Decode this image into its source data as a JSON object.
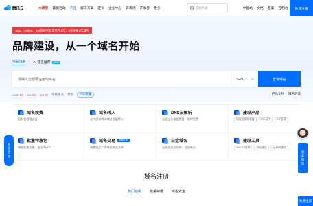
{
  "nav": {
    "brand": "腾讯云",
    "items": [
      {
        "label": "大模型",
        "style": "hot"
      },
      {
        "label": "最新活动",
        "style": ""
      },
      {
        "label": "产品",
        "style": "act"
      },
      {
        "label": "解决方案",
        "style": ""
      },
      {
        "label": "定价",
        "style": ""
      },
      {
        "label": "企业中心",
        "style": ""
      },
      {
        "label": "云市场",
        "style": ""
      },
      {
        "label": "开发者",
        "style": ""
      },
      {
        "label": "更多",
        "style": ""
      }
    ],
    "search_placeholder": "云服务器",
    "right": [
      "中国站",
      "文档",
      "备案",
      "控制台",
      "登录"
    ],
    "cta": "免费注册"
  },
  "hero": {
    "promo": ".site、.online、.fun等域名首年低至1元，9元注册1年域名",
    "title": "品牌建设，从一个域名开始",
    "tab_active": "域名注册",
    "tab_other": "AI 域名推荐",
    "tab_badge": "NEW",
    "search_placeholder": "请输入您想要注册的域名",
    "tld": ".com",
    "search_button": "查询域名",
    "prices": [
      {
        "tld": ".com",
        "price": "83"
      },
      {
        "tld": ".cn",
        "price": "33"
      },
      {
        "tld": ".net",
        "price": "86"
      }
    ],
    "price_label": "价格总览",
    "more": "更多",
    "more_link": "Cbe优惠",
    "right_links": [
      "产品文档",
      "域名验证"
    ]
  },
  "services": [
    {
      "title": "域名续费",
      "desc": "招财合规赠送证",
      "badge": "",
      "chips": []
    },
    {
      "title": "域名转入",
      "desc": "支持首次转入域名批量转入",
      "badge": "",
      "chips": []
    },
    {
      "title": "DNS云解析",
      "desc": "全面企业级配置管，限时免费",
      "badge": "",
      "chips": []
    },
    {
      "title": "建站产品",
      "desc": "",
      "badge": "",
      "chips": [
        "轻量应用服务器",
        "SSL证书",
        "ICP备案"
      ]
    },
    {
      "title": "批量特惠包",
      "desc": "域名批量注册，低至4元/个",
      "badge": "",
      "chips": []
    },
    {
      "title": "域名交易",
      "desc": "海量精品二手域名安全交易",
      "badge": "全新上线",
      "chips": []
    },
    {
      "title": "白金域名",
      "desc": "企业全方位防护，过目难忘",
      "badge": "",
      "chips": []
    },
    {
      "title": "建站工具",
      "desc": "",
      "badge": "",
      "chips": [
        "WHOIS查询",
        "网站建设",
        "云开网建站"
      ]
    }
  ],
  "floats": {
    "left": "更多活动",
    "right": "联系销售",
    "bottom": "免费注册"
  },
  "section": {
    "title": "域名注册",
    "tabs": [
      "热门后缀",
      "批量特惠",
      "域名安全"
    ]
  }
}
